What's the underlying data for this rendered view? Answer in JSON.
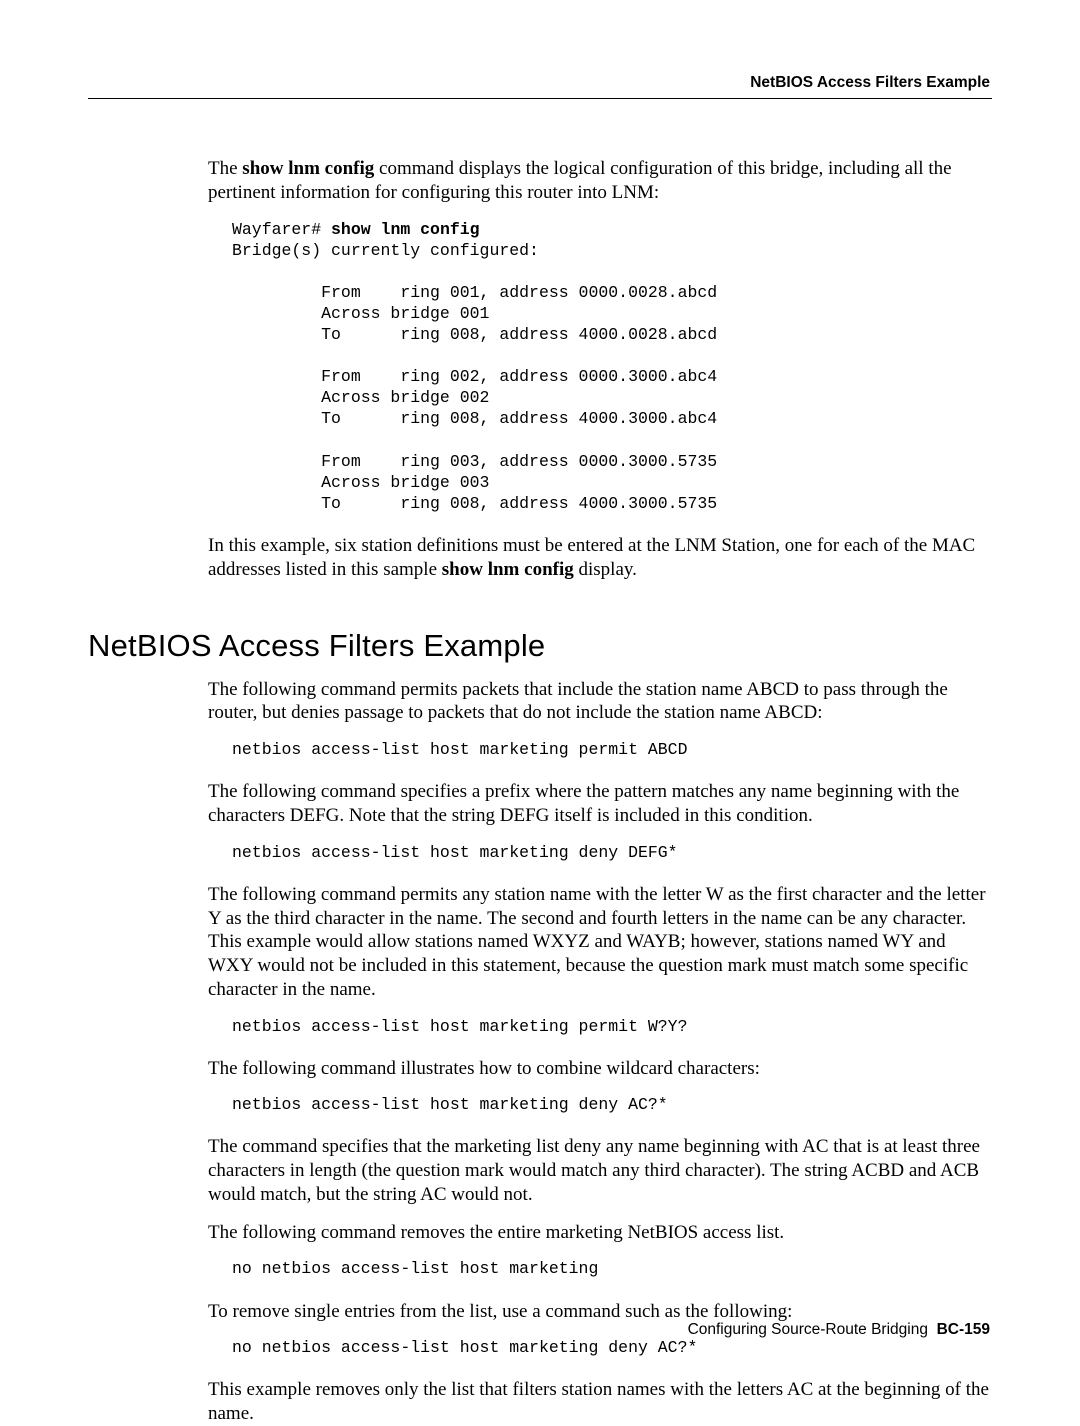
{
  "header": {
    "running_title": "NetBIOS Access Filters Example"
  },
  "intro": {
    "p1_a": "The ",
    "p1_b": "show lnm config",
    "p1_c": " command displays the logical configuration of this bridge, including all the pertinent information for configuring this router into LNM:"
  },
  "code1": {
    "prompt": "Wayfarer# ",
    "cmd": "show lnm config",
    "rest": "Bridge(s) currently configured:\n\n         From    ring 001, address 0000.0028.abcd\n         Across bridge 001\n         To      ring 008, address 4000.0028.abcd\n\n         From    ring 002, address 0000.3000.abc4\n         Across bridge 002\n         To      ring 008, address 4000.3000.abc4\n\n         From    ring 003, address 0000.3000.5735\n         Across bridge 003\n         To      ring 008, address 4000.3000.5735"
  },
  "intro2": {
    "p2_a": "In this example, six station definitions must be entered at the LNM Station, one for each of the MAC addresses listed in this sample ",
    "p2_b": "show lnm config",
    "p2_c": " display."
  },
  "section_heading": "NetBIOS Access Filters Example",
  "body": {
    "p1": "The following command permits packets that include the station name ABCD to pass through the router, but denies passage to packets that do not include the station name ABCD:",
    "c1": "netbios access-list host marketing permit ABCD",
    "p2": "The following command specifies a prefix where the pattern matches any name beginning with the characters DEFG. Note that the string DEFG itself is included in this condition.",
    "c2": "netbios access-list host marketing deny DEFG*",
    "p3": "The following command permits any station name with the letter W as the first character and the letter Y as the third character in the name. The second and fourth letters in the name can be any character. This example would allow stations named WXYZ and WAYB; however, stations named WY and WXY would not be included in this statement, because the question mark must match some specific character in the name.",
    "c3": "netbios access-list host marketing permit W?Y?",
    "p4": "The following command illustrates how to combine wildcard characters:",
    "c4": "netbios access-list host marketing deny AC?*",
    "p5": "The command specifies that the marketing list deny any name beginning with AC that is at least three characters in length (the question mark would match any third character). The string ACBD and ACB would match, but the string AC would not.",
    "p6": "The following command removes the entire marketing NetBIOS access list.",
    "c5": "no netbios access-list host marketing",
    "p7": "To remove single entries from the list, use a command such as the following:",
    "c6": "no netbios access-list host marketing deny AC?*",
    "p8": "This example removes only the list that filters station names with the letters AC at the beginning of the name."
  },
  "footer": {
    "text": "Configuring Source-Route Bridging",
    "page": "BC-159"
  }
}
